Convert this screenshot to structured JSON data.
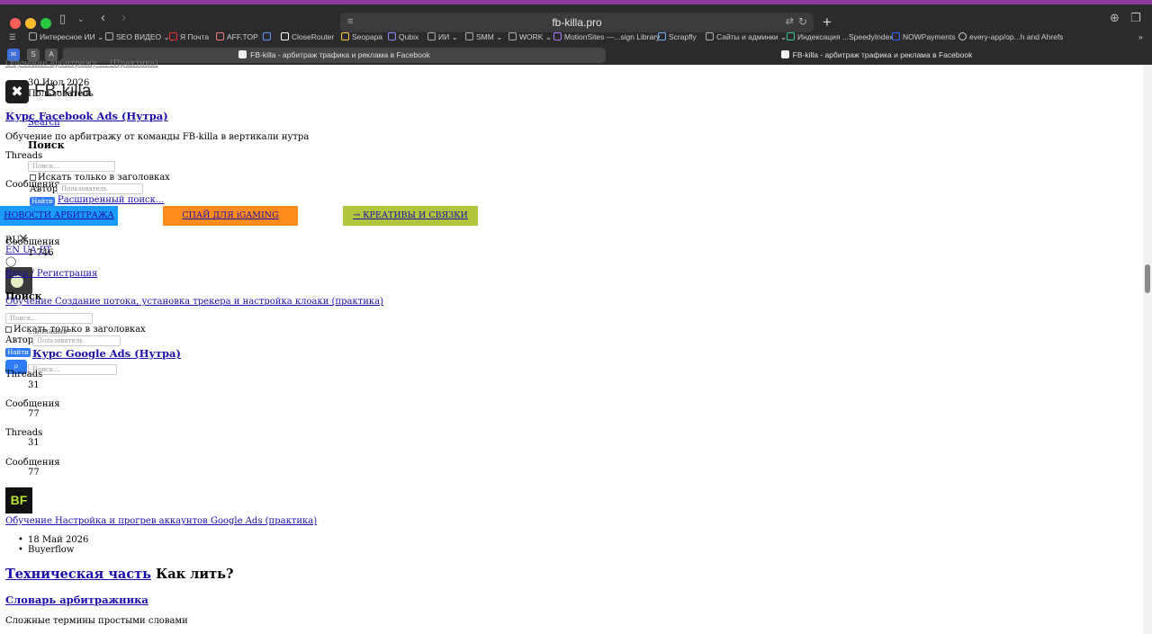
{
  "browser": {
    "url": "fb-killa.pro",
    "bookmarks": [
      "Интересное ИИ",
      "SEO ВИДЕО",
      "Я Почта",
      "AFF.TOP",
      "CloseRouter",
      "Seopapa",
      "Qubix",
      "ИИ",
      "SMM",
      "WORK",
      "MotionSites —...sign Library",
      "Scrapfly",
      "Сайты и админки",
      "Индексация ...SpeedyIndex",
      "NOWPayments",
      "every-app/op...h and Ahrefs"
    ],
    "pinned_tabs": [
      "S",
      "A"
    ],
    "tab_active_title": "FB-killa - арбитраж трафика и реклама в Facebook",
    "tab_inactive_title": "FB-killa - арбитраж трафика и реклама в Facebook"
  },
  "page": {
    "top_cut_link": "Обучение арбитражу ... (Практика)",
    "date_1": "30 Июл 2026",
    "author_1": "Пользователь",
    "logo_text": "FB-killa",
    "course_fb_title": "Курс Facebook Ads (Нутра)",
    "search_link": "Search",
    "course_fb_desc": "Обучение по арбитражу от команды FB-killa в вертикали нутра",
    "search_heading": "Поиск",
    "threads_label": "Threads",
    "search_placeholder": "Поиск...",
    "only_titles": "Искать только в заголовках",
    "author_label": "Автор:",
    "user_placeholder": "Пользователь",
    "messages_label": "Сообщения",
    "find_btn": "Найти",
    "advanced_search": "Расширенный поиск...",
    "banner_news": "НОВОСТИ АРБИТРАЖА",
    "banner_spy": "СПАЙ ДЛЯ iGAMING",
    "banner_creatives": "→ КРЕАТИВЫ И СВЯЗКИ",
    "messages_label_2": "Сообщения",
    "lang_ru": "RU",
    "lang_others": "EN UA PT",
    "messages_count_1": "1 746",
    "register_link": "Вход / Регистрация",
    "search_heading_2": "Поиск",
    "course_stream_link": "Обучение Создание потока, установка трекера и настройка клоаки (практика)",
    "only_titles_2": "Искать только в заголовках",
    "author_label_2": "Автор:",
    "user_placeholder_2": "Пользователь",
    "find_btn_2": "Найти",
    "course_google_title": "Курс Google Ads (Нутра)",
    "author_cut": "...иллааыв",
    "threads_cut": "Threads",
    "stat_threads_1": "31",
    "messages_3": "Сообщения",
    "stat_messages_1": "77",
    "threads_2": "Threads",
    "stat_threads_2": "31",
    "messages_4": "Сообщения",
    "stat_messages_2": "77",
    "bf_logo": "BF",
    "google_setup_link": "Обучение Настройка и прогрев аккаунтов Google Ads (практика)",
    "date_2": "18 Май 2026",
    "author_2": "Buyerflow",
    "tech_part_link": "Техническая часть",
    "tech_part_rest": "Как лить?",
    "dictionary_link": "Словарь арбитражника",
    "dictionary_desc": "Сложные термины простыми словами"
  },
  "colors": {
    "banner_news": "#1a9bf5",
    "banner_spy": "#ff8c1a",
    "banner_creatives": "#b2c53a",
    "search_button": "#2f7cf6",
    "link": "#1a0dab"
  },
  "scroll": {
    "thumb_position_fraction": 0.35,
    "thumb_size_fraction": 0.05
  }
}
